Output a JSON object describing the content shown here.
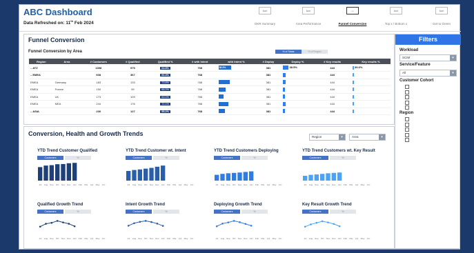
{
  "app": {
    "title": "ABC Dashboard",
    "refreshed_prefix": "Data Refreshed on: 11",
    "refreshed_sup": "th",
    "refreshed_suffix": " Feb 2024"
  },
  "nav": [
    {
      "icon": "Icon",
      "label": "OKR Summary",
      "active": false
    },
    {
      "icon": "Icon",
      "label": "Area Performance",
      "active": false
    },
    {
      "icon": "",
      "label": "Funnel Conversion",
      "active": true
    },
    {
      "icon": "Icon",
      "label": "Top x / Bottom x",
      "active": false
    },
    {
      "icon": "Icon",
      "label": "Get to Green",
      "active": false
    }
  ],
  "funnel": {
    "title": "Funnel Conversion",
    "subtitle": "Funnel Conversion by Area",
    "toggle_active": "% of Totals",
    "toggle_inactive": "% of Region",
    "columns": [
      "Region",
      "Area",
      "# Customers",
      "# Qualified",
      "Qualified %",
      "# with Intent",
      "with Intent %",
      "# Deploy",
      "Deploy %",
      "# Key results",
      "Key results %"
    ],
    "rows": [
      {
        "region": "ATZ",
        "area": "",
        "customers": "1308",
        "qualified": "975",
        "qualified_pct": "64.8%",
        "intent": "768",
        "intent_pct": "38.9%",
        "deploy": "381",
        "deploy_pct": "38.5%",
        "key": "444",
        "key_pct": "39.6%",
        "level": "region",
        "intent_fill": 1.0,
        "deploy_fill": 1.0
      },
      {
        "region": "EMEA",
        "area": "",
        "customers": "608",
        "qualified": "367",
        "qualified_pct": "60.3%",
        "intent": "768",
        "intent_pct": "",
        "deploy": "381",
        "deploy_pct": "",
        "key": "444",
        "key_pct": "",
        "level": "region",
        "intent_fill": 0.0,
        "deploy_fill": 0.45
      },
      {
        "region": "EMEA",
        "area": "Germany",
        "customers": "183",
        "qualified": "133",
        "qualified_pct": "73.8%",
        "intent": "768",
        "intent_pct": "",
        "deploy": "381",
        "deploy_pct": "",
        "key": "444",
        "key_pct": "",
        "level": "area",
        "intent_fill": 0.9,
        "deploy_fill": 0.5
      },
      {
        "region": "EMEA",
        "area": "France",
        "customers": "150",
        "qualified": "99",
        "qualified_pct": "66.0%",
        "intent": "768",
        "intent_pct": "",
        "deploy": "381",
        "deploy_pct": "",
        "key": "444",
        "key_pct": "",
        "level": "area",
        "intent_fill": 0.55,
        "deploy_fill": 0.35
      },
      {
        "region": "EMEA",
        "area": "UK",
        "customers": "173",
        "qualified": "109",
        "qualified_pct": "63.0%",
        "intent": "768",
        "intent_pct": "",
        "deploy": "381",
        "deploy_pct": "",
        "key": "444",
        "key_pct": "",
        "level": "area",
        "intent_fill": 0.4,
        "deploy_fill": 0.3
      },
      {
        "region": "EMEA",
        "area": "MEA",
        "customers": "244",
        "qualified": "176",
        "qualified_pct": "72.1%",
        "intent": "768",
        "intent_pct": "",
        "deploy": "381",
        "deploy_pct": "",
        "key": "444",
        "key_pct": "",
        "level": "area",
        "intent_fill": 0.8,
        "deploy_fill": 0.45
      },
      {
        "region": "ASIA",
        "area": "",
        "customers": "230",
        "qualified": "127",
        "qualified_pct": "55.2%",
        "intent": "768",
        "intent_pct": "",
        "deploy": "381",
        "deploy_pct": "",
        "key": "444",
        "key_pct": "",
        "level": "region",
        "intent_fill": 0.5,
        "deploy_fill": 0.3
      }
    ]
  },
  "trends": {
    "title": "Conversion, Health and Growth Trends",
    "select_region": "Region",
    "select_area": "Area",
    "tab_active": "Customers",
    "tab_inactive": "%",
    "months": [
      "Jul",
      "Aug",
      "Sep",
      "Oct",
      "Nov",
      "Dec",
      "Jan",
      "Feb",
      "Mar",
      "Apr",
      "May",
      "Jun"
    ],
    "charts": [
      {
        "title": "YTD Trend Customer Qualified",
        "type": "bar",
        "color": "#1f3f78",
        "values": [
          70,
          78,
          80,
          85,
          86,
          90,
          92,
          0,
          0,
          0,
          0,
          0
        ]
      },
      {
        "title": "YTD Trend Customer wt. Intent",
        "type": "bar",
        "color": "#2b5ea8",
        "values": [
          50,
          55,
          58,
          62,
          66,
          72,
          78,
          0,
          0,
          0,
          0,
          0
        ]
      },
      {
        "title": "YTD Trend Customers Deploying",
        "type": "bar",
        "color": "#2f7de0",
        "values": [
          30,
          35,
          38,
          40,
          42,
          45,
          48,
          0,
          0,
          0,
          0,
          0
        ]
      },
      {
        "title": "YTD Trend Customers wt. Key Result",
        "type": "bar",
        "color": "#4aa3f5",
        "values": [
          25,
          30,
          32,
          35,
          38,
          40,
          42,
          0,
          0,
          0,
          0,
          0
        ]
      },
      {
        "title": "Qualified Growth Trend",
        "type": "line",
        "color": "#1f3f78",
        "values": [
          40,
          55,
          60,
          70,
          62,
          55,
          42,
          null,
          null,
          null,
          null,
          null
        ]
      },
      {
        "title": "Intent Growth Trend",
        "type": "line",
        "color": "#2b5ea8",
        "values": [
          45,
          58,
          65,
          70,
          64,
          56,
          44,
          null,
          null,
          null,
          null,
          null
        ]
      },
      {
        "title": "Deploying Growth Trend",
        "type": "line",
        "color": "#2f7de0",
        "values": [
          42,
          56,
          62,
          70,
          63,
          54,
          45,
          null,
          null,
          null,
          null,
          null
        ]
      },
      {
        "title": "Key Result Growth Trend",
        "type": "line",
        "color": "#4aa3f5",
        "values": [
          40,
          52,
          60,
          68,
          62,
          54,
          42,
          null,
          null,
          null,
          null,
          null
        ]
      }
    ]
  },
  "filters": {
    "title": "Filters",
    "workload_label": "Workload",
    "workload_value": "SCIM",
    "service_label": "Service/Feature",
    "service_value": "All",
    "cohort_label": "Customer Cohort",
    "cohort_count": 5,
    "region_label": "Region",
    "region_count": 5
  },
  "colors": {
    "brand": "#1f5fa8",
    "accent": "#2f75e6",
    "background": "#1b3a6b",
    "header": "#4a4f58"
  }
}
